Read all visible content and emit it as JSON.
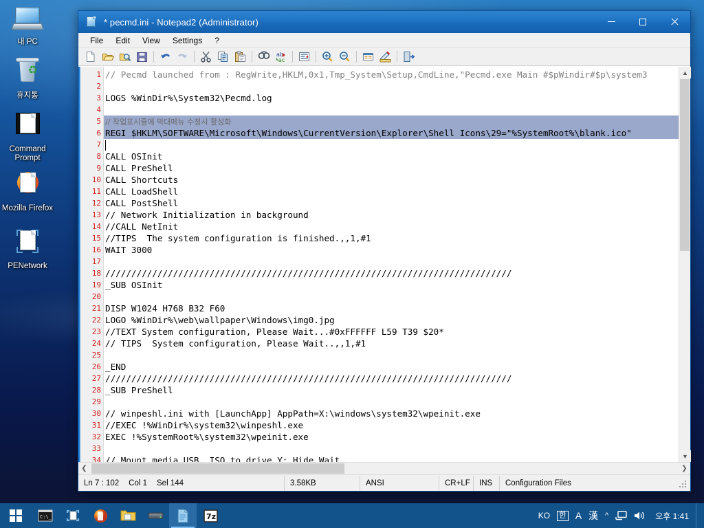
{
  "desktop": {
    "icons": [
      {
        "label": "내 PC",
        "icon": "my-computer-icon"
      },
      {
        "label": "휴지통",
        "icon": "recycle-bin-icon"
      },
      {
        "label": "Command Prompt",
        "icon": "command-prompt-icon"
      },
      {
        "label": "Mozilla Firefox",
        "icon": "firefox-icon"
      },
      {
        "label": "PENetwork",
        "icon": "penetwork-icon"
      }
    ]
  },
  "window": {
    "title": "* pecmd.ini - Notepad2 (Administrator)",
    "icon": "notepad2-icon",
    "buttons": {
      "minimize": "minimize-button",
      "maximize": "maximize-button",
      "close": "close-button"
    }
  },
  "menu": {
    "items": [
      "File",
      "Edit",
      "View",
      "Settings",
      "?"
    ]
  },
  "toolbar": {
    "buttons": [
      {
        "name": "new-file-icon",
        "tip": "New"
      },
      {
        "name": "open-file-icon",
        "tip": "Open"
      },
      {
        "name": "browse-file-icon",
        "tip": "Browse"
      },
      {
        "name": "save-file-icon",
        "tip": "Save"
      },
      {
        "name": "undo-icon",
        "tip": "Undo"
      },
      {
        "name": "redo-icon",
        "tip": "Redo"
      },
      {
        "name": "cut-icon",
        "tip": "Cut"
      },
      {
        "name": "copy-icon",
        "tip": "Copy"
      },
      {
        "name": "paste-icon",
        "tip": "Paste"
      },
      {
        "name": "find-icon",
        "tip": "Find"
      },
      {
        "name": "replace-icon",
        "tip": "Replace"
      },
      {
        "name": "block-indent-icon",
        "tip": "Block Indent"
      },
      {
        "name": "zoom-in-icon",
        "tip": "Zoom In"
      },
      {
        "name": "zoom-out-icon",
        "tip": "Zoom Out"
      },
      {
        "name": "scheme-icon",
        "tip": "Scheme"
      },
      {
        "name": "scheme-options-icon",
        "tip": "Scheme Options"
      },
      {
        "name": "exit-icon",
        "tip": "Exit"
      }
    ]
  },
  "editor": {
    "first_line": 1,
    "selected_lines": [
      5,
      6
    ],
    "caret_line": 7,
    "lines": [
      {
        "n": 1,
        "text": "// Pecmd launched from : RegWrite,HKLM,0x1,Tmp_System\\Setup,CmdLine,\"Pecmd.exe Main #$pWindir#$p\\system3",
        "style": "comment"
      },
      {
        "n": 2,
        "text": "",
        "style": "plain"
      },
      {
        "n": 3,
        "text": "LOGS %WinDir%\\System32\\Pecmd.log",
        "style": "plain"
      },
      {
        "n": 4,
        "text": "",
        "style": "plain"
      },
      {
        "n": 5,
        "text": "// 작업표시줄에 막대메뉴 수정시 활성화",
        "style": "comment-korean"
      },
      {
        "n": 6,
        "text": "REGI $HKLM\\SOFTWARE\\Microsoft\\Windows\\CurrentVersion\\Explorer\\Shell Icons\\29=\"%SystemRoot%\\blank.ico\"",
        "style": "plain"
      },
      {
        "n": 7,
        "text": "",
        "style": "plain"
      },
      {
        "n": 8,
        "text": "CALL OSInit",
        "style": "plain"
      },
      {
        "n": 9,
        "text": "CALL PreShell",
        "style": "plain"
      },
      {
        "n": 10,
        "text": "CALL Shortcuts",
        "style": "plain"
      },
      {
        "n": 11,
        "text": "CALL LoadShell",
        "style": "plain"
      },
      {
        "n": 12,
        "text": "CALL PostShell",
        "style": "plain"
      },
      {
        "n": 13,
        "text": "// Network Initialization in background",
        "style": "plain"
      },
      {
        "n": 14,
        "text": "//CALL NetInit",
        "style": "plain"
      },
      {
        "n": 15,
        "text": "//TIPS  The system configuration is finished.,,1,#1",
        "style": "plain"
      },
      {
        "n": 16,
        "text": "WAIT 3000",
        "style": "plain"
      },
      {
        "n": 17,
        "text": "",
        "style": "plain"
      },
      {
        "n": 18,
        "text": "//////////////////////////////////////////////////////////////////////////////",
        "style": "plain"
      },
      {
        "n": 19,
        "text": "_SUB OSInit",
        "style": "plain"
      },
      {
        "n": 20,
        "text": "",
        "style": "plain"
      },
      {
        "n": 21,
        "text": "DISP W1024 H768 B32 F60",
        "style": "plain"
      },
      {
        "n": 22,
        "text": "LOGO %WinDir%\\web\\wallpaper\\Windows\\img0.jpg",
        "style": "plain"
      },
      {
        "n": 23,
        "text": "//TEXT System configuration, Please Wait...#0xFFFFFF L59 T39 $20*",
        "style": "plain"
      },
      {
        "n": 24,
        "text": "// TIPS  System configuration, Please Wait..,,1,#1",
        "style": "plain"
      },
      {
        "n": 25,
        "text": "",
        "style": "plain"
      },
      {
        "n": 26,
        "text": "_END",
        "style": "plain"
      },
      {
        "n": 27,
        "text": "//////////////////////////////////////////////////////////////////////////////",
        "style": "plain"
      },
      {
        "n": 28,
        "text": "_SUB PreShell",
        "style": "plain"
      },
      {
        "n": 29,
        "text": "",
        "style": "plain"
      },
      {
        "n": 30,
        "text": "// winpeshl.ini with [LaunchApp] AppPath=X:\\windows\\system32\\wpeinit.exe",
        "style": "plain"
      },
      {
        "n": 31,
        "text": "//EXEC !%WinDir%\\system32\\winpeshl.exe",
        "style": "plain"
      },
      {
        "n": 32,
        "text": "EXEC !%SystemRoot%\\system32\\wpeinit.exe",
        "style": "plain"
      },
      {
        "n": 33,
        "text": "",
        "style": "plain"
      },
      {
        "n": 34,
        "text": "// Mount media USB, ISO to drive Y: Hide Wait",
        "style": "plain"
      }
    ]
  },
  "statusbar": {
    "position": "Ln 7 : 102",
    "column": "Col 1",
    "selection": "Sel 144",
    "filesize": "3.58KB",
    "encoding": "ANSI",
    "lineending": "CR+LF",
    "insertmode": "INS",
    "scheme": "Configuration Files"
  },
  "taskbar": {
    "start": "start-button",
    "items": [
      {
        "name": "taskbar-command-prompt",
        "icon": "command-prompt-icon",
        "active": false
      },
      {
        "name": "taskbar-penetwork",
        "icon": "penetwork-icon",
        "active": false
      },
      {
        "name": "taskbar-firefox",
        "icon": "firefox-icon",
        "active": false
      },
      {
        "name": "taskbar-explorer",
        "icon": "folder-icon",
        "active": false
      },
      {
        "name": "taskbar-drive",
        "icon": "drive-icon",
        "active": false
      },
      {
        "name": "taskbar-notepad2",
        "icon": "notepad2-icon",
        "active": true
      },
      {
        "name": "taskbar-7zip",
        "icon": "sevenzip-icon",
        "active": false
      }
    ],
    "tray": {
      "lang": "KO",
      "ime_mode": "한",
      "ime_alpha": "A",
      "ime_hanja": "漢",
      "overflow": "chevron-up-icon",
      "network": "network-icon",
      "volume": "volume-icon",
      "clock": "오후 1:41"
    }
  },
  "colors": {
    "titlebar": "#1a6bbb",
    "taskbar": "#12538c",
    "linenumber": "#d42222",
    "selection": "#9aa8cc",
    "comment": "#808080"
  }
}
